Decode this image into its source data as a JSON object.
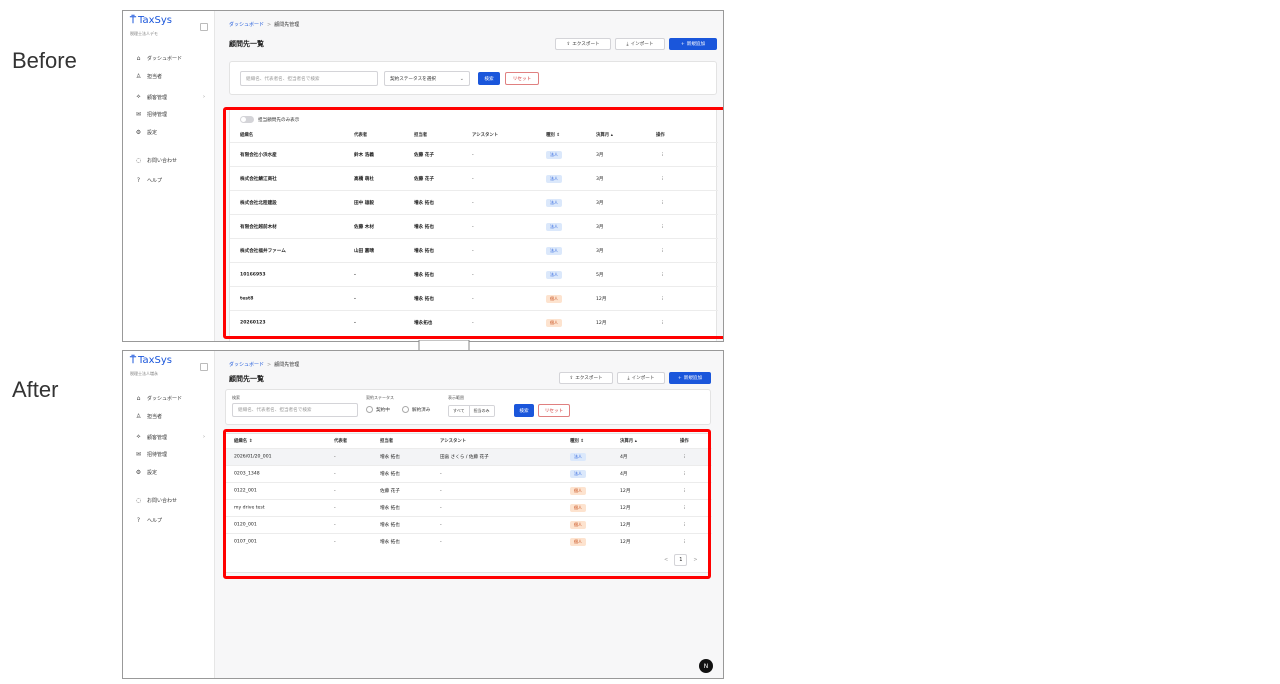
{
  "labels": {
    "before": "Before",
    "after": "After"
  },
  "colors": {
    "accent": "#1a56db",
    "highlight": "#ff0000",
    "corp_badge": "#dbe8fb",
    "indiv_badge": "#fde3cf"
  },
  "sidebar": {
    "logo": "TaxSys",
    "firm": "税理士法人デモ",
    "firm_after": "税理士法人増永",
    "items": [
      {
        "label": "ダッシュボード",
        "icon": "home-icon"
      },
      {
        "label": "担当者",
        "icon": "person-icon"
      },
      {
        "label": "顧客管理",
        "icon": "customers-icon"
      },
      {
        "label": "招待管理",
        "icon": "mail-icon"
      },
      {
        "label": "設定",
        "icon": "gear-icon"
      },
      {
        "label": "お問い合わせ",
        "icon": "chat-icon"
      },
      {
        "label": "ヘルプ",
        "icon": "help-icon"
      }
    ]
  },
  "header": {
    "crumb_root": "ダッシュボード",
    "crumb_sep": ">",
    "crumb_current": "顧問先管理",
    "title": "顧問先一覧",
    "export_label": "エクスポート",
    "import_label": "インポート",
    "add_label": "新規追加"
  },
  "before": {
    "search_placeholder": "組織名、代表者名、担当者名で検索",
    "status_select": "契約ステータスを選択",
    "search_btn": "検索",
    "reset_btn": "リセット",
    "toggle_label": "担当顧問先のみ表示",
    "columns": [
      "組織名",
      "代表者",
      "担当者",
      "アシスタント",
      "種別 ⇕",
      "決算月 ▴",
      "操作"
    ],
    "rows": [
      {
        "name": "有限会社小浜水産",
        "rep": "鈴木 浩義",
        "staff": "佐藤 花子",
        "asst": "-",
        "type": "法人",
        "month": "3月"
      },
      {
        "name": "株式会社鯖江商社",
        "rep": "高橋 萌杜",
        "staff": "佐藤 花子",
        "asst": "-",
        "type": "法人",
        "month": "3月"
      },
      {
        "name": "株式会社北陸建設",
        "rep": "田中 雄毅",
        "staff": "増永 拓也",
        "asst": "-",
        "type": "法人",
        "month": "3月"
      },
      {
        "name": "有限会社越前木材",
        "rep": "佐藤 木材",
        "staff": "増永 拓也",
        "asst": "-",
        "type": "法人",
        "month": "3月"
      },
      {
        "name": "株式会社福井ファーム",
        "rep": "山田 嘉晴",
        "staff": "増永 拓也",
        "asst": "-",
        "type": "法人",
        "month": "3月"
      },
      {
        "name": "10166953",
        "rep": "-",
        "staff": "増永 拓也",
        "asst": "-",
        "type": "法人",
        "month": "5月"
      },
      {
        "name": "test8",
        "rep": "-",
        "staff": "増永 拓也",
        "asst": "-",
        "type": "個人",
        "month": "12月"
      },
      {
        "name": "20260123",
        "rep": "-",
        "staff": "増永拓也",
        "asst": "-",
        "type": "個人",
        "month": "12月"
      }
    ]
  },
  "after": {
    "search_label": "検索",
    "search_placeholder": "組織名、代表者名、担当者名で検索",
    "status_label": "契約ステータス",
    "status_options": [
      "契約中",
      "解約済み"
    ],
    "scope_label": "表示範囲",
    "scope_options": [
      "すべて",
      "担当のみ"
    ],
    "search_btn": "検索",
    "reset_btn": "リセット",
    "columns": [
      "組織名 ⇕",
      "代表者",
      "担当者",
      "アシスタント",
      "種別 ⇕",
      "決算月 ▴",
      "操作"
    ],
    "rows": [
      {
        "name": "2026/01/20_001",
        "rep": "-",
        "staff": "増永 拓也",
        "asst": "田畠 さくら / 佐藤 花子",
        "type": "法人",
        "month": "4月"
      },
      {
        "name": "0203_1348",
        "rep": "-",
        "staff": "増永 拓也",
        "asst": "-",
        "type": "法人",
        "month": "4月"
      },
      {
        "name": "0122_001",
        "rep": "-",
        "staff": "佐藤 花子",
        "asst": "-",
        "type": "個人",
        "month": "12月"
      },
      {
        "name": "my drive test",
        "rep": "-",
        "staff": "増永 拓也",
        "asst": "-",
        "type": "個人",
        "month": "12月"
      },
      {
        "name": "0120_001",
        "rep": "-",
        "staff": "増永 拓也",
        "asst": "-",
        "type": "個人",
        "month": "12月"
      },
      {
        "name": "0107_001",
        "rep": "-",
        "staff": "増永 拓也",
        "asst": "-",
        "type": "個人",
        "month": "12月"
      }
    ],
    "page": "1",
    "prev": "<",
    "next": ">",
    "fab": "N"
  },
  "menu_dots": "⋮"
}
